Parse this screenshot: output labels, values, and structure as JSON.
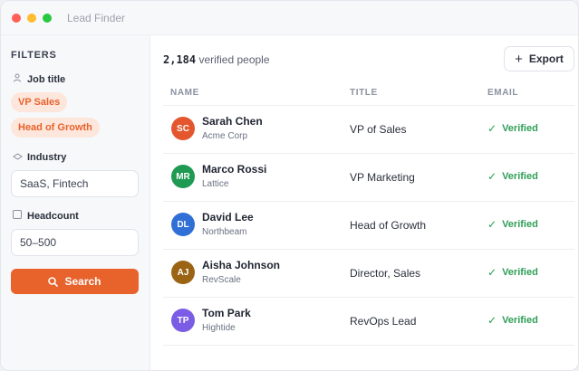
{
  "app": {
    "title": "Lead Finder"
  },
  "sidebar": {
    "heading": "FILTERS",
    "job_title": {
      "label": "Job title",
      "chips": [
        "VP Sales",
        "Head of Growth"
      ]
    },
    "industry": {
      "label": "Industry",
      "value": "SaaS, Fintech"
    },
    "headcount": {
      "label": "Headcount",
      "value": "50–500"
    },
    "search_label": "Search"
  },
  "main": {
    "count": "2,184",
    "count_suffix": "verified people",
    "export_label": "Export",
    "columns": {
      "name": "NAME",
      "title": "TITLE",
      "email": "EMAIL"
    },
    "rows": [
      {
        "initials": "SC",
        "name": "Sarah Chen",
        "company": "Acme Corp",
        "title": "VP of Sales",
        "status": "Verified",
        "color": "#e4572e"
      },
      {
        "initials": "MR",
        "name": "Marco Rossi",
        "company": "Lattice",
        "title": "VP Marketing",
        "status": "Verified",
        "color": "#1f9a52"
      },
      {
        "initials": "DL",
        "name": "David Lee",
        "company": "Northbeam",
        "title": "Head of Growth",
        "status": "Verified",
        "color": "#2f6fd6"
      },
      {
        "initials": "AJ",
        "name": "Aisha Johnson",
        "company": "RevScale",
        "title": "Director, Sales",
        "status": "Verified",
        "color": "#9a6414"
      },
      {
        "initials": "TP",
        "name": "Tom Park",
        "company": "Hightide",
        "title": "RevOps Lead",
        "status": "Verified",
        "color": "#7b5ce5"
      }
    ]
  },
  "colors": {
    "accent": "#e8622c",
    "verified": "#2e9e57"
  }
}
